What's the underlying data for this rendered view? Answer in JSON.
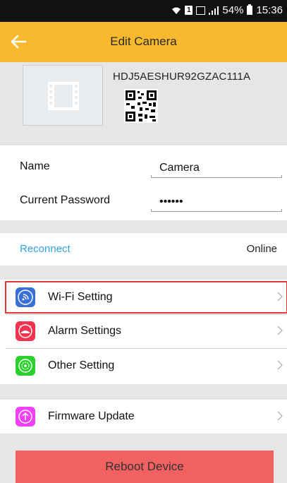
{
  "status_bar": {
    "battery": "54%",
    "time": "15:36",
    "sim_label": "1"
  },
  "header": {
    "title": "Edit Camera",
    "back_icon": "back-arrow-icon"
  },
  "device": {
    "id": "HDJ5AESHUR92GZAC111A",
    "thumbnail_icon": "film-icon",
    "qr_icon": "qr-code-icon"
  },
  "fields": {
    "name": {
      "label": "Name",
      "value": "Camera"
    },
    "password": {
      "label": "Current Password",
      "value": "••••••"
    }
  },
  "connection": {
    "reconnect_label": "Reconnect",
    "status": "Online"
  },
  "menu": [
    {
      "label": "Wi-Fi Setting",
      "icon": "wifi-icon",
      "color": "#3b6fd8"
    },
    {
      "label": "Alarm Settings",
      "icon": "alarm-icon",
      "color": "#f2334f"
    },
    {
      "label": "Other Setting",
      "icon": "settings-icon",
      "color": "#2bd12b"
    },
    {
      "label": "Firmware Update",
      "icon": "firmware-update-icon",
      "color": "#f23ef6"
    }
  ],
  "reboot": {
    "label": "Reboot Device",
    "color": "#f26161"
  },
  "colors": {
    "header": "#f9b92e",
    "accent": "#2fa6e0",
    "highlight_border": "#e23a3a"
  }
}
